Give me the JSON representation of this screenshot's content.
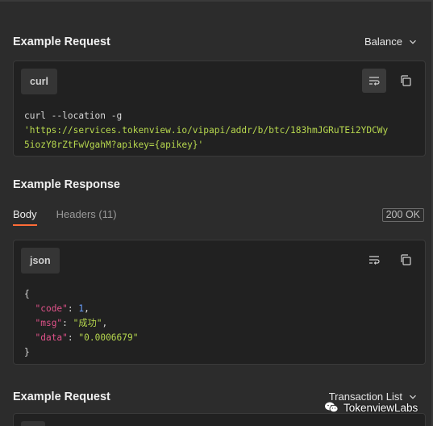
{
  "request1": {
    "title": "Example Request",
    "dropdown_value": "Balance",
    "lang": "curl",
    "code_line1": "curl --location -g",
    "code_line2": "'https://services.tokenview.io/vipapi/addr/b/btc/183hmJGRuTEi2YDCWy",
    "code_line3": "5iozY8rZtFwVgahM?apikey={apikey}'"
  },
  "response": {
    "title": "Example Response",
    "tabs": [
      "Body",
      "Headers (11)"
    ],
    "status": "200 OK",
    "lang": "json",
    "json_open": "{",
    "json_close": "}",
    "fields": [
      {
        "key": "\"code\"",
        "value": "1",
        "type": "num",
        "trail": ","
      },
      {
        "key": "\"msg\"",
        "value": "\"成功\"",
        "type": "str",
        "trail": ","
      },
      {
        "key": "\"data\"",
        "value": "\"0.0006679\"",
        "type": "str",
        "trail": ""
      }
    ]
  },
  "request2": {
    "title": "Example Request",
    "dropdown_value": "Transaction List"
  },
  "watermark": {
    "text": "TokenviewLabs",
    "icon": "wechat-icon"
  },
  "icons": {
    "wrap": "wrap-lines-icon",
    "copy": "copy-icon",
    "chevron": "chevron-down-icon"
  },
  "colors": {
    "background": "#2c2c2c",
    "panel": "#212121",
    "accent_tab": "#ff6c37",
    "string": "#b7d84e",
    "key": "#e0528a",
    "number": "#6aa0ff"
  }
}
